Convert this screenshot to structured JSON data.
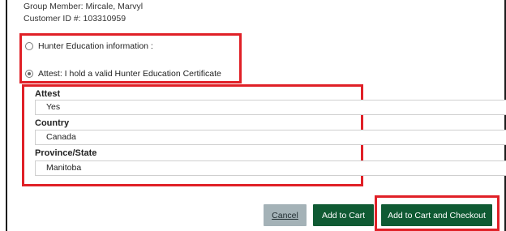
{
  "group_member": "Group Member: Mircale, Marvyl",
  "customer_id": "Customer ID #: 103310959",
  "options": [
    {
      "label": "Hunter Education information :",
      "checked": false
    },
    {
      "label": "Attest: I hold a valid Hunter Education Certificate",
      "checked": true
    }
  ],
  "fields": {
    "attest": {
      "label": "Attest",
      "value": "Yes"
    },
    "country": {
      "label": "Country",
      "value": "Canada"
    },
    "province": {
      "label": "Province/State",
      "value": "Manitoba"
    }
  },
  "buttons": {
    "cancel": "Cancel",
    "add_to_cart": "Add to Cart",
    "add_to_cart_checkout": "Add to Cart and Checkout"
  },
  "colors": {
    "highlight": "#e02027",
    "primary_button": "#0f5a33",
    "cancel_button": "#a4b2b7"
  }
}
